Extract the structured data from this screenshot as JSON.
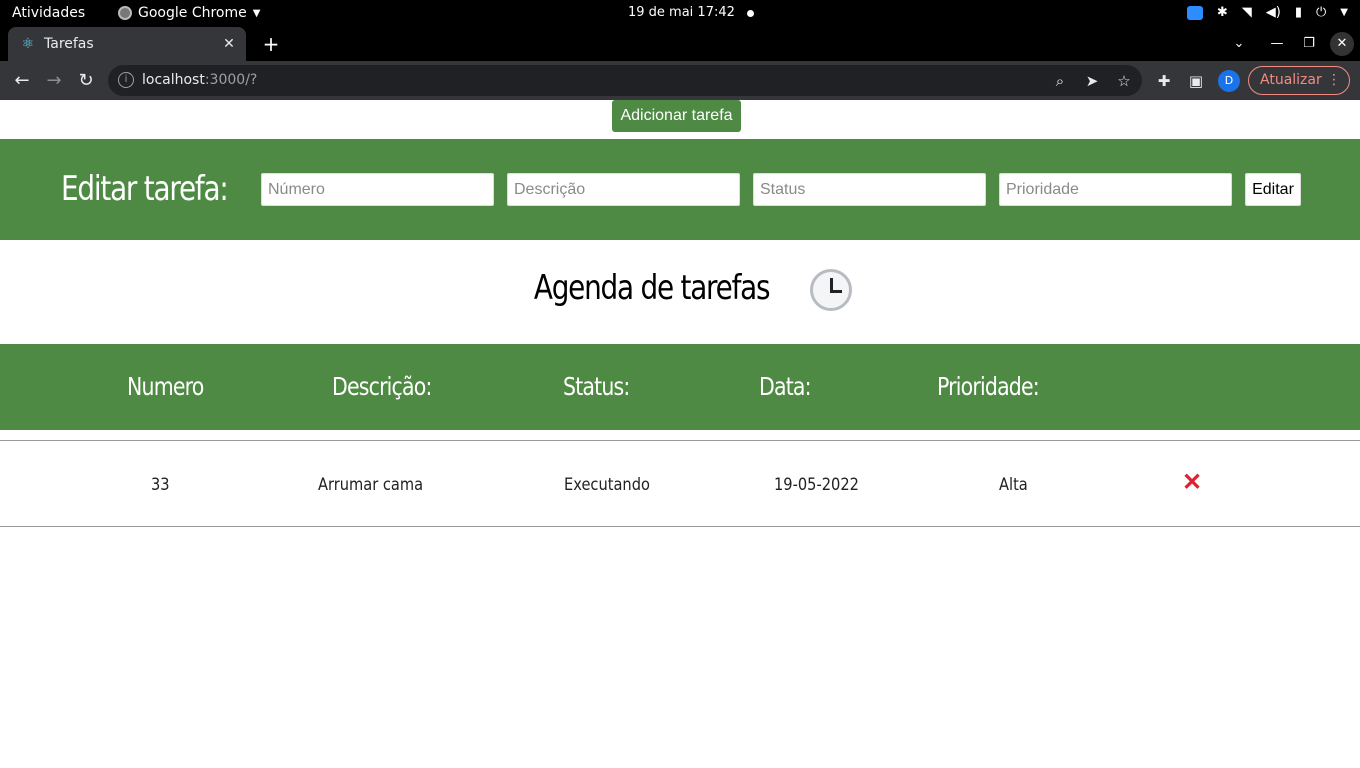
{
  "system_bar": {
    "activities": "Atividades",
    "app_name": "Google Chrome",
    "clock": "19 de mai  17:42"
  },
  "browser": {
    "tab_title": "Tarefas",
    "url_host": "localhost",
    "url_rest": ":3000/?",
    "update_label": "Atualizar",
    "profile_initial": "D"
  },
  "page": {
    "add_button": "Adicionar tarefa",
    "edit": {
      "title": "Editar tarefa:",
      "numero_placeholder": "Número",
      "descricao_placeholder": "Descrição",
      "status_placeholder": "Status",
      "prioridade_placeholder": "Prioridade",
      "button": "Editar"
    },
    "agenda_title": "Agenda de tarefas",
    "table": {
      "headers": [
        "Numero",
        "Descrição:",
        "Status:",
        "Data:",
        "Prioridade:"
      ],
      "rows": [
        {
          "numero": "33",
          "descricao": "Arrumar cama",
          "status": "Executando",
          "data": "19-05-2022",
          "prioridade": "Alta"
        }
      ]
    }
  },
  "colors": {
    "accent_green": "#4e8a44",
    "delete_red": "#dd2233"
  }
}
